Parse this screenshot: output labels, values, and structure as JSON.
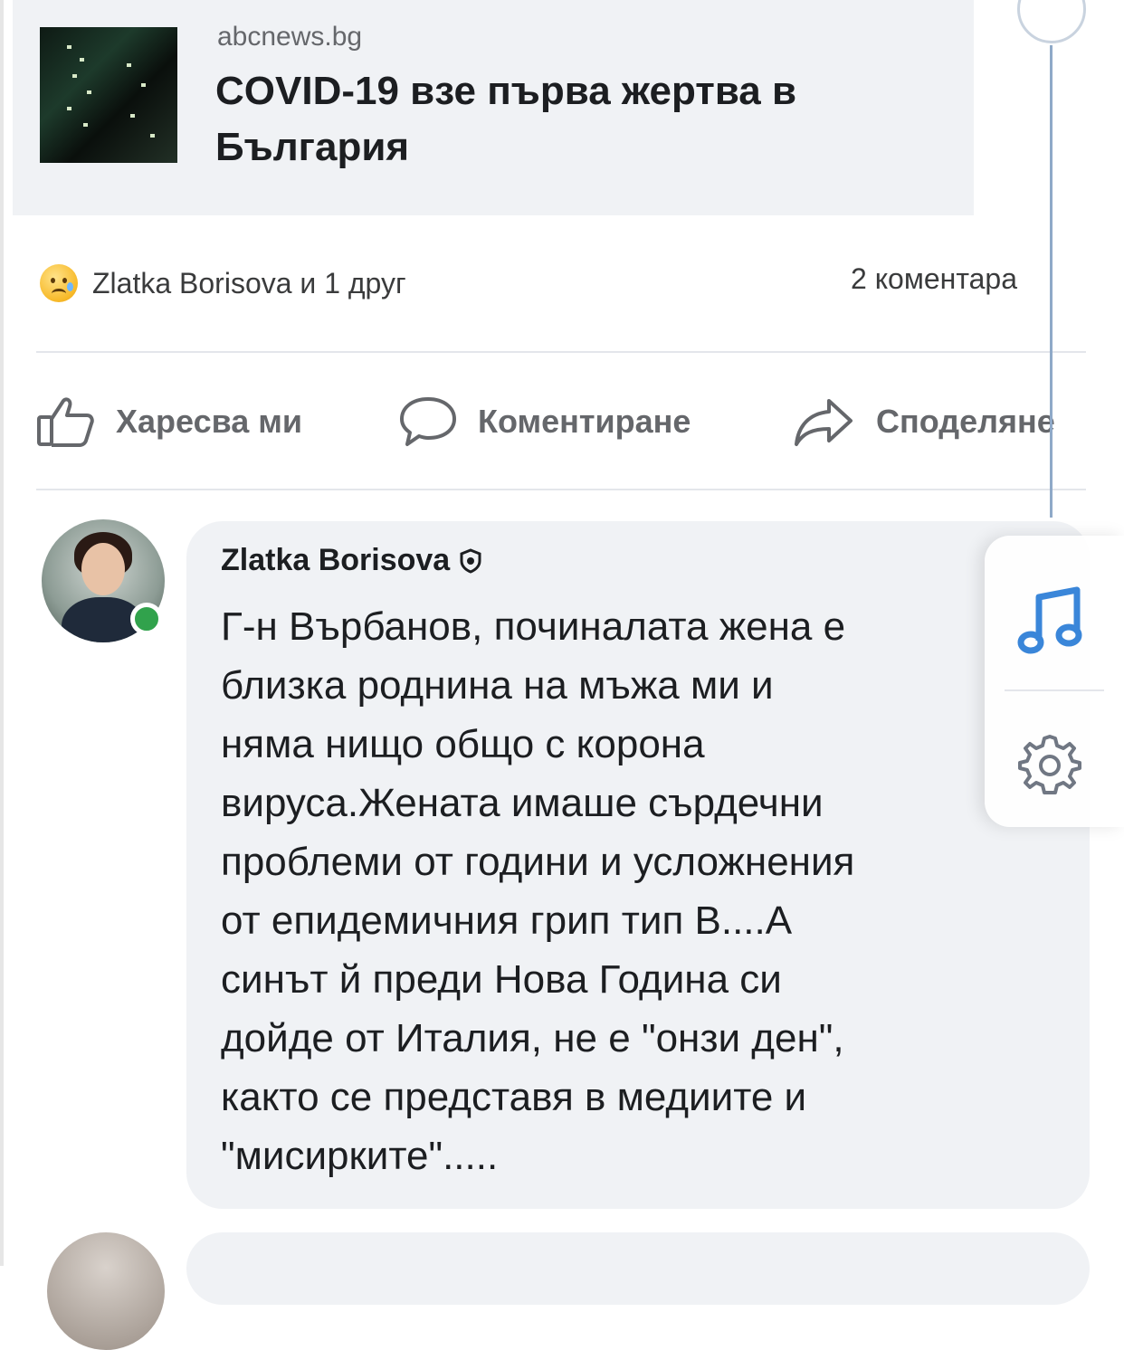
{
  "link_preview": {
    "source": "abcnews.bg",
    "headline": "COVID-19 взе първа жертва в България"
  },
  "reactions": {
    "emoji_icon": "sad-reaction-icon",
    "summary": "Zlatka Borisova и 1 друг",
    "comments_count": "2 коментара"
  },
  "actions": {
    "like_label": "Харесва ми",
    "comment_label": "Коментиране",
    "share_label": "Споделяне"
  },
  "comment": {
    "author": "Zlatka Borisova",
    "text": "Г-н Върбанов, починалата жена е\nблизка роднина на мъжа ми и\nняма нищо общо с корона\nвируса.Жената имаше сърдечни\nпроблеми от години и усложнения\nот епидемичния грип тип В....А\nсинът й преди Нова Година си\nдойде от Италия, не е \"онзи ден\",\nкакто се представя в медиите и\n\"мисирките\"....."
  },
  "side_tools": {
    "music_icon": "music-note-icon",
    "settings_icon": "gear-icon"
  },
  "colors": {
    "card_bg": "#f0f2f5",
    "text": "#1c1e21",
    "muted": "#65676b",
    "online": "#31a24c",
    "accent": "#1877f2"
  }
}
